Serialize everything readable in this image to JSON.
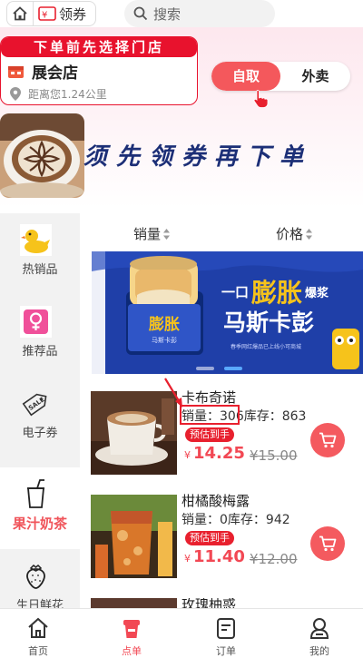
{
  "header": {
    "coupon_label": "领券",
    "search_placeholder": "搜索"
  },
  "store": {
    "hint": "下单前先选择门店",
    "name": "展会店",
    "distance": "距离您1.24公里"
  },
  "order_mode": {
    "pickup": "自取",
    "delivery": "外卖"
  },
  "banner": {
    "slogan": "须先领券再下单"
  },
  "categories": [
    {
      "label": "热销品",
      "icon": "duck-icon"
    },
    {
      "label": "推荐品",
      "icon": "female-icon"
    },
    {
      "label": "电子券",
      "icon": "sale-tag-icon"
    },
    {
      "label": "果汁奶茶",
      "icon": "cup-icon",
      "active": true
    },
    {
      "label": "生日鲜花",
      "icon": "strawberry-icon"
    }
  ],
  "sort": {
    "sales": "销量",
    "price": "价格"
  },
  "promo": {
    "tagline_pre": "一口",
    "tagline_big": "膨胀",
    "tagline_post": "爆浆",
    "product": "马斯卡彭",
    "sub": "春季网红爆品已上线小可商城",
    "cup_text": "膨胀"
  },
  "products": [
    {
      "name": "卡布奇诺",
      "sales_label": "销量：",
      "sales": "306",
      "stock_label": "库存：",
      "stock": "863",
      "badge": "预估到手",
      "currency": "¥",
      "price": "14.25",
      "original_price": "¥15.00"
    },
    {
      "name": "柑橘酸梅露",
      "sales_label": "销量：",
      "sales": "0",
      "stock_label": "库存：",
      "stock": "942",
      "badge": "预估到手",
      "currency": "¥",
      "price": "11.40",
      "original_price": "¥12.00"
    },
    {
      "name": "玫瑰柚惑"
    }
  ],
  "bottom_nav": [
    {
      "label": "首页",
      "icon": "home-icon"
    },
    {
      "label": "点单",
      "icon": "cup-order-icon",
      "active": true
    },
    {
      "label": "订单",
      "icon": "document-icon"
    },
    {
      "label": "我的",
      "icon": "user-icon"
    }
  ],
  "colors": {
    "accent": "#f24854",
    "store_red": "#e8122d",
    "slogan_blue": "#1c2f77",
    "promo_blue": "#1f3fa8"
  }
}
